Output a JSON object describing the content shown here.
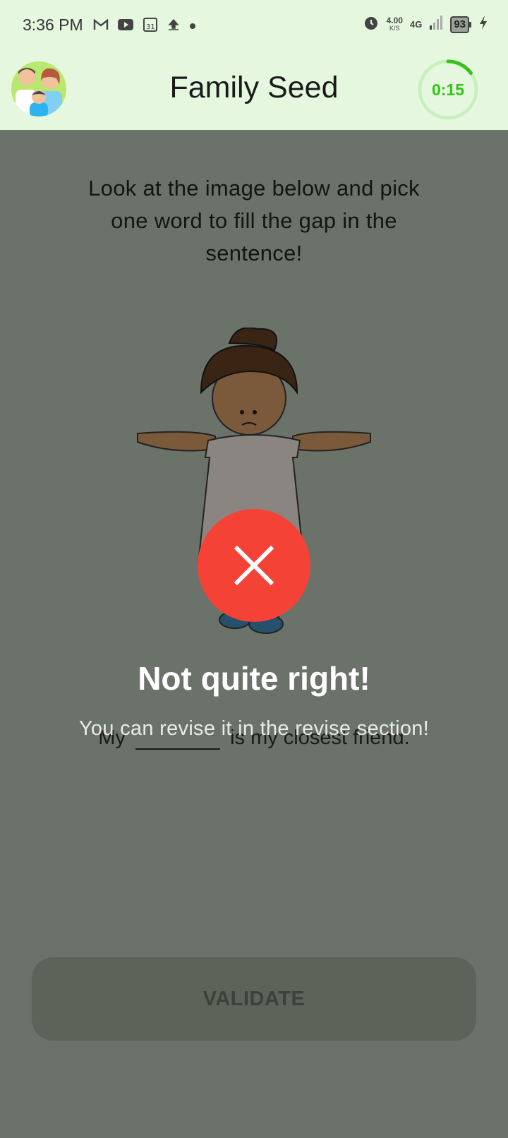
{
  "status_bar": {
    "time": "3:36 PM",
    "network_speed_value": "4.00",
    "network_speed_unit": "K/S",
    "network_type": "4G",
    "battery": "93"
  },
  "header": {
    "title": "Family Seed",
    "timer": "0:15",
    "timer_progress": 0.15
  },
  "exercise": {
    "instruction": "Look at the image below and pick one word to fill the gap in the sentence!",
    "sentence_before": "My",
    "sentence_after": "is my closest friend."
  },
  "validate_label": "VALIDATE",
  "feedback": {
    "title": "Not quite right!",
    "message": "You can revise it in the revise section!"
  },
  "colors": {
    "header_bg": "#e6f7df",
    "timer_accent": "#34c31b",
    "error": "#f44336",
    "dim_overlay": "#6b7269"
  }
}
